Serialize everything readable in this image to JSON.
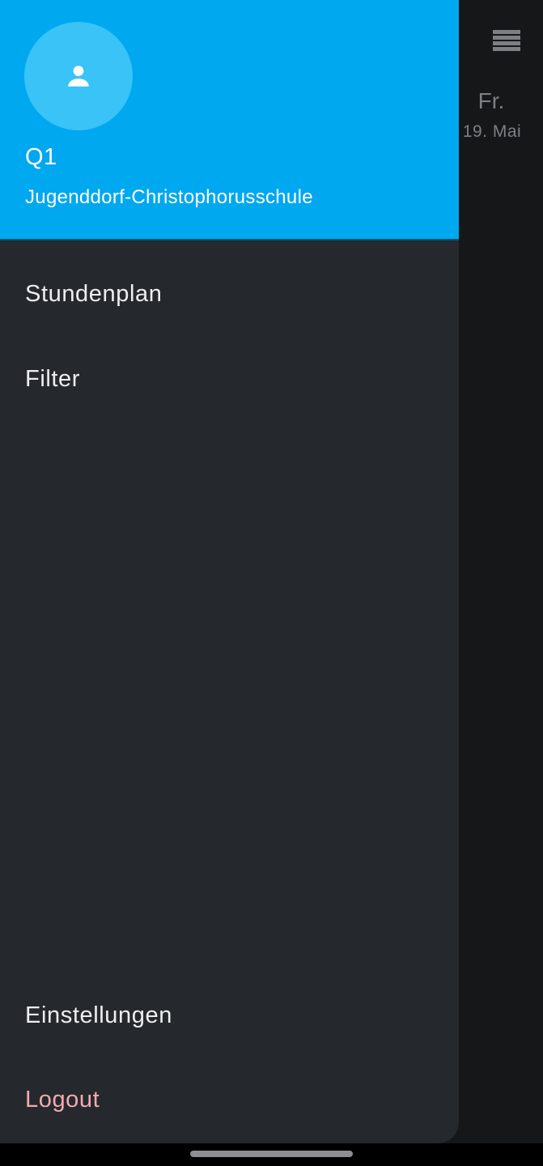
{
  "background_view": {
    "day_label": "Fr.",
    "date_label": "19. Mai",
    "menu_icon": "menu-icon"
  },
  "drawer": {
    "header": {
      "avatar_icon": "person-icon",
      "title": "Q1",
      "subtitle": "Jugenddorf-Christophorusschule"
    },
    "items": [
      {
        "label": "Stundenplan"
      },
      {
        "label": "Filter"
      }
    ],
    "footer_items": [
      {
        "label": "Einstellungen"
      },
      {
        "label": "Logout"
      }
    ]
  },
  "colors": {
    "header_bg": "#00a8ef",
    "avatar_bg": "#39c3f6",
    "drawer_bg": "#25292d",
    "logout_text": "#f2aab0",
    "app_bg": "#161719"
  }
}
